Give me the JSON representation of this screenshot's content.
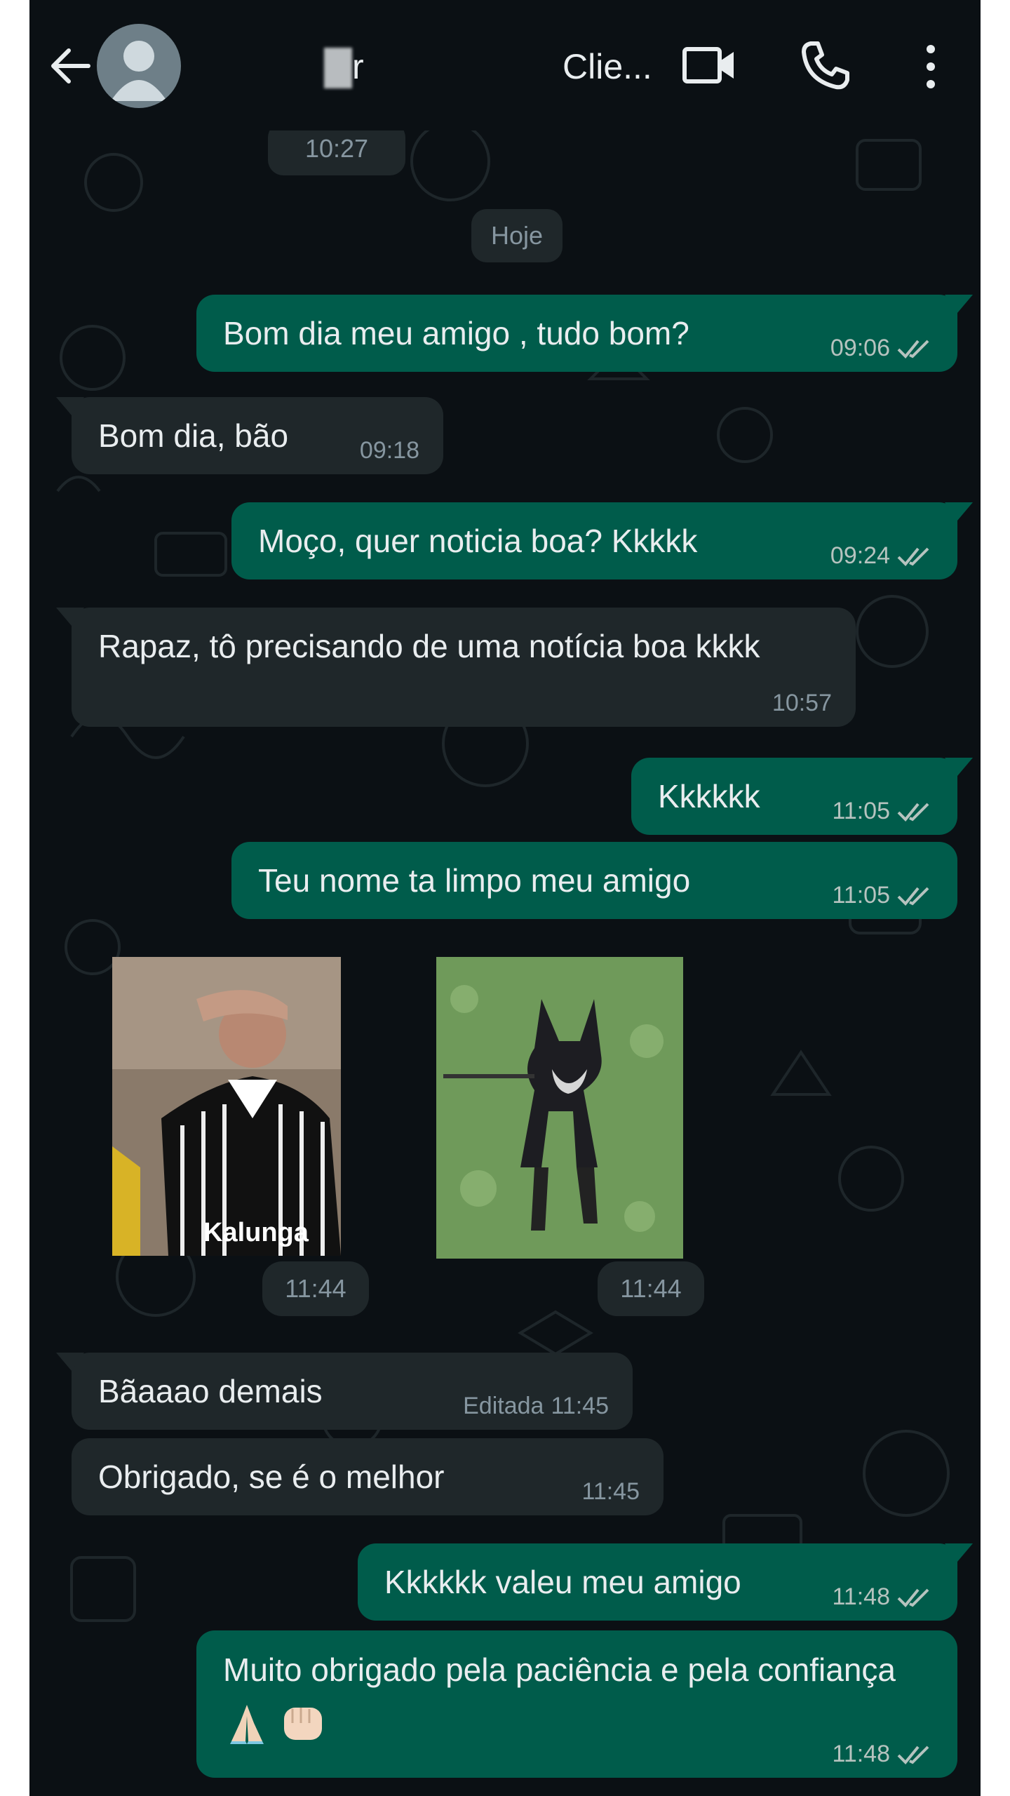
{
  "header": {
    "title_visible_1": "r",
    "title_visible_2": "Clie...",
    "back_icon": "arrow-left-icon",
    "avatar_icon": "default-avatar-icon",
    "video_icon": "video-camera-icon",
    "call_icon": "phone-icon",
    "menu_icon": "more-vertical-icon"
  },
  "previous_time": "10:27",
  "date_chip": "Hoje",
  "messages": [
    {
      "dir": "out",
      "text": "Bom dia meu amigo , tudo bom?",
      "time": "09:06",
      "status": "read"
    },
    {
      "dir": "in",
      "text": "Bom dia, bão",
      "time": "09:18"
    },
    {
      "dir": "out",
      "text": "Moço, quer noticia boa? Kkkkk",
      "time": "09:24",
      "status": "read"
    },
    {
      "dir": "in",
      "text": "Rapaz, tô precisando de uma notícia boa kkkk",
      "time": "10:57"
    },
    {
      "dir": "out",
      "text": "Kkkkkk",
      "time": "11:05",
      "status": "read"
    },
    {
      "dir": "out",
      "text": "Teu nome ta limpo meu amigo",
      "time": "11:05",
      "status": "read"
    },
    {
      "dir": "in",
      "type": "sticker",
      "subject": "man-saluting-sticker",
      "time": "11:44"
    },
    {
      "dir": "in",
      "type": "sticker",
      "subject": "dog-running-sticker",
      "time": "11:44"
    },
    {
      "dir": "in",
      "text": "Bãaaao demais",
      "edited_label": "Editada",
      "time": "11:45"
    },
    {
      "dir": "in",
      "text": "Obrigado, se é o melhor",
      "time": "11:45"
    },
    {
      "dir": "out",
      "text": "Kkkkkk valeu meu amigo",
      "time": "11:48",
      "status": "read"
    },
    {
      "dir": "out",
      "text": "Muito obrigado pela paciência e pela confiança",
      "emoji": [
        "folded-hands-emoji",
        "fist-bump-emoji"
      ],
      "time": "11:48",
      "status": "read"
    }
  ],
  "sticker_jersey_text": "Kalunga",
  "colors": {
    "background": "#0b1014",
    "outgoing_bubble": "#005c4b",
    "incoming_bubble": "#1f272a",
    "text": "#e9edef",
    "meta": "#8696a0"
  }
}
